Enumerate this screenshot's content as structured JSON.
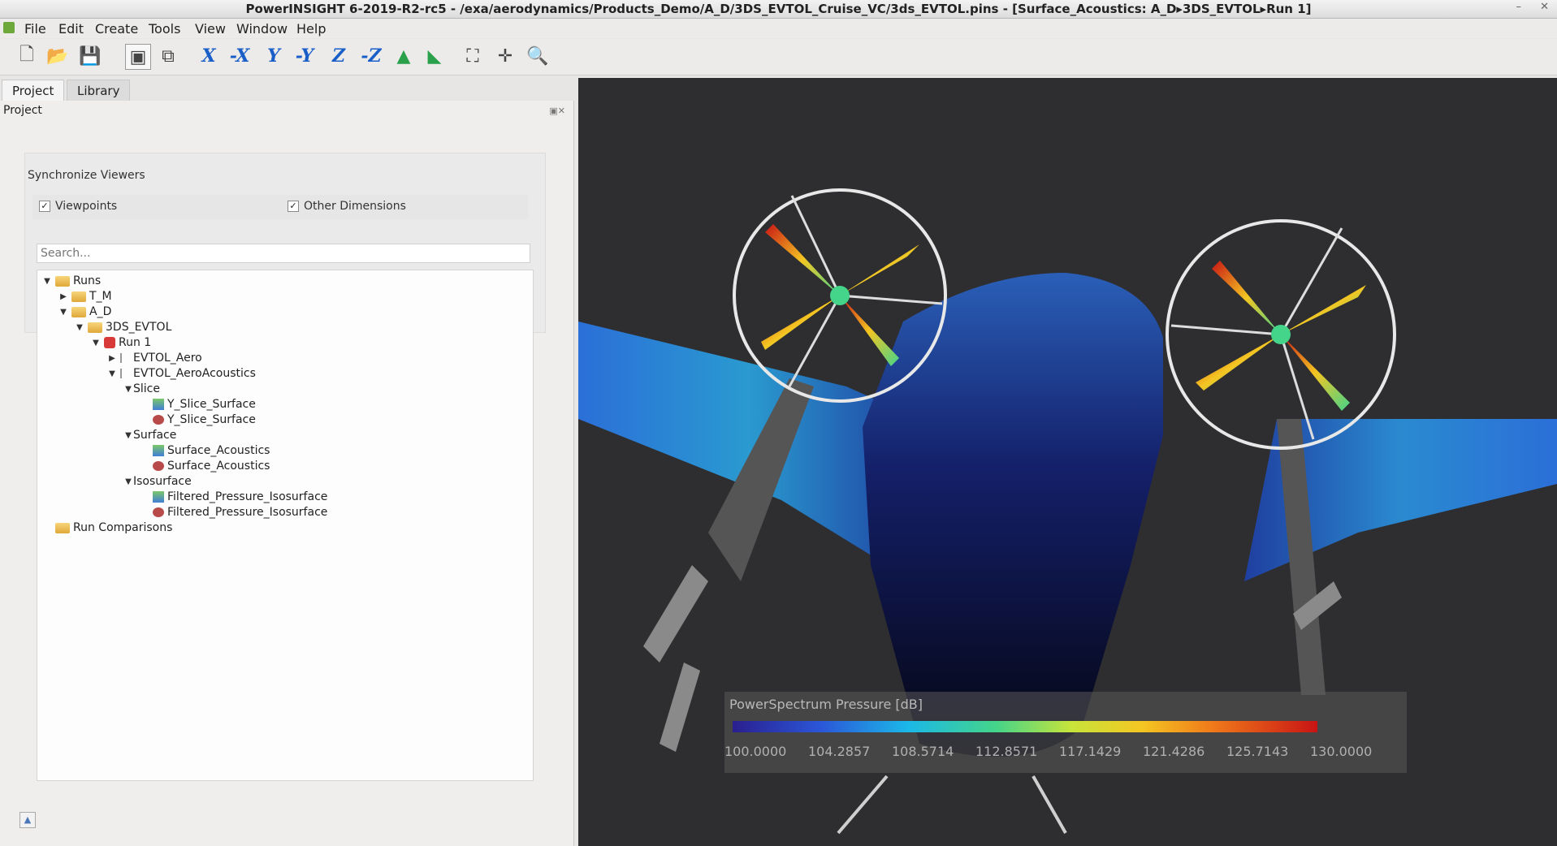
{
  "window": {
    "title": "PowerINSIGHT 6-2019-R2-rc5 - /exa/aerodynamics/Products_Demo/A_D/3DS_EVTOL_Cruise_VC/3ds_EVTOL.pins - [Surface_Acoustics: A_D▸3DS_EVTOL▸Run 1]"
  },
  "menu": [
    "File",
    "Edit",
    "Create",
    "Tools",
    "View",
    "Window",
    "Help"
  ],
  "toolbar": {
    "file_icons": [
      "new-file-icon",
      "open-file-icon",
      "save-icon"
    ],
    "view_icons": [
      "single-view-icon",
      "multi-view-icon"
    ],
    "axis_buttons": [
      "X",
      "-X",
      "Y",
      "-Y",
      "Z",
      "-Z"
    ],
    "other_icons": [
      "iso-view-icon",
      "flip-view-icon",
      "fit-view-icon",
      "center-icon",
      "zoom-icon"
    ]
  },
  "tabs": [
    "Project",
    "Library"
  ],
  "panel": {
    "title": "Project",
    "sync_label": "Synchronize Viewers",
    "checkboxes": [
      {
        "label": "Viewpoints",
        "checked": true
      },
      {
        "label": "Other Dimensions",
        "checked": true
      }
    ],
    "search_placeholder": "Search..."
  },
  "tree": [
    {
      "label": "Runs",
      "level": 0,
      "icon": "folder",
      "expanded": true
    },
    {
      "label": "T_M",
      "level": 1,
      "icon": "folder",
      "expanded": false
    },
    {
      "label": "A_D",
      "level": 1,
      "icon": "folder",
      "expanded": true
    },
    {
      "label": "3DS_EVTOL",
      "level": 2,
      "icon": "folder",
      "expanded": true
    },
    {
      "label": "Run 1",
      "level": 3,
      "icon": "run",
      "expanded": true
    },
    {
      "label": "EVTOL_Aero",
      "level": 4,
      "icon": "sim",
      "expanded": false
    },
    {
      "label": "EVTOL_AeroAcoustics",
      "level": 4,
      "icon": "sim",
      "expanded": true
    },
    {
      "label": "Slice",
      "level": 5,
      "icon": "none",
      "expanded": true
    },
    {
      "label": "Y_Slice_Surface",
      "level": 6,
      "icon": "image"
    },
    {
      "label": "Y_Slice_Surface",
      "level": 6,
      "icon": "movie"
    },
    {
      "label": "Surface",
      "level": 5,
      "icon": "none",
      "expanded": true
    },
    {
      "label": "Surface_Acoustics",
      "level": 6,
      "icon": "image"
    },
    {
      "label": "Surface_Acoustics",
      "level": 6,
      "icon": "movie"
    },
    {
      "label": "Isosurface",
      "level": 5,
      "icon": "none",
      "expanded": true
    },
    {
      "label": "Filtered_Pressure_Isosurface",
      "level": 6,
      "icon": "image"
    },
    {
      "label": "Filtered_Pressure_Isosurface",
      "level": 6,
      "icon": "movie"
    },
    {
      "label": "Run Comparisons",
      "level": 0,
      "icon": "folder"
    }
  ],
  "legend": {
    "title": "PowerSpectrum Pressure [dB]",
    "ticks": [
      "100.0000",
      "104.2857",
      "108.5714",
      "112.8571",
      "117.1429",
      "121.4286",
      "125.7143",
      "130.0000"
    ],
    "colors": [
      "#2a1f8e",
      "#2b56d8",
      "#1bb8e8",
      "#44d48a",
      "#c8e43a",
      "#f4c622",
      "#f07a1a",
      "#c81414"
    ]
  }
}
